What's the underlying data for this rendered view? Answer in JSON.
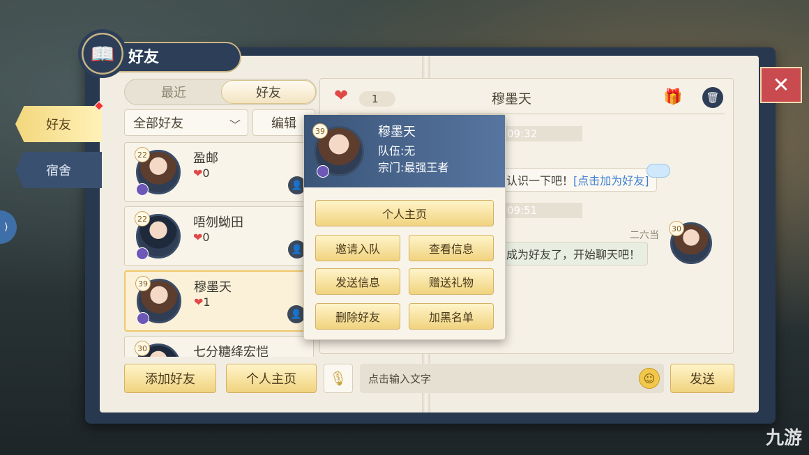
{
  "window": {
    "title": "好友"
  },
  "side_tabs": [
    {
      "label": "好友",
      "active": true
    },
    {
      "label": "宿舍",
      "active": false
    }
  ],
  "segment": {
    "recent": "最近",
    "friends": "好友"
  },
  "filter": {
    "value": "全部好友",
    "edit": "编辑"
  },
  "friends": [
    {
      "level": "22",
      "name": "盈邮",
      "hearts": "0"
    },
    {
      "level": "22",
      "name": "唔刎蚴田",
      "hearts": "0"
    },
    {
      "level": "39",
      "name": "穆墨天",
      "hearts": "1",
      "selected": true
    },
    {
      "level": "30",
      "name": "七分糖绛宏恺",
      "hearts": ""
    }
  ],
  "bottom": {
    "add_friend": "添加好友",
    "profile": "个人主页",
    "input_placeholder": "点击输入文字",
    "send": "发送"
  },
  "chat": {
    "heart_count": "1",
    "title": "穆墨天",
    "messages": [
      {
        "time": "09:32"
      },
      {
        "text": "认识一下吧！",
        "link": "[点击加为好友]"
      },
      {
        "time": "09:51"
      },
      {
        "sender": "二六当",
        "level": "30",
        "text": "成为好友了，开始聊天吧！"
      }
    ]
  },
  "popup": {
    "level": "39",
    "name": "穆墨天",
    "team": "队伍:无",
    "sect": "宗门:最强王者",
    "buttons": {
      "profile": "个人主页",
      "invite": "邀请入队",
      "view_info": "查看信息",
      "send_message": "发送信息",
      "gift": "赠送礼物",
      "delete": "删除好友",
      "blacklist": "加黑名单"
    }
  },
  "watermark": "九游",
  "colors": {
    "accent_gold": "#f0d37f",
    "panel_navy": "#28384f",
    "heart_red": "#e04848",
    "close_red": "#c94a4f"
  }
}
